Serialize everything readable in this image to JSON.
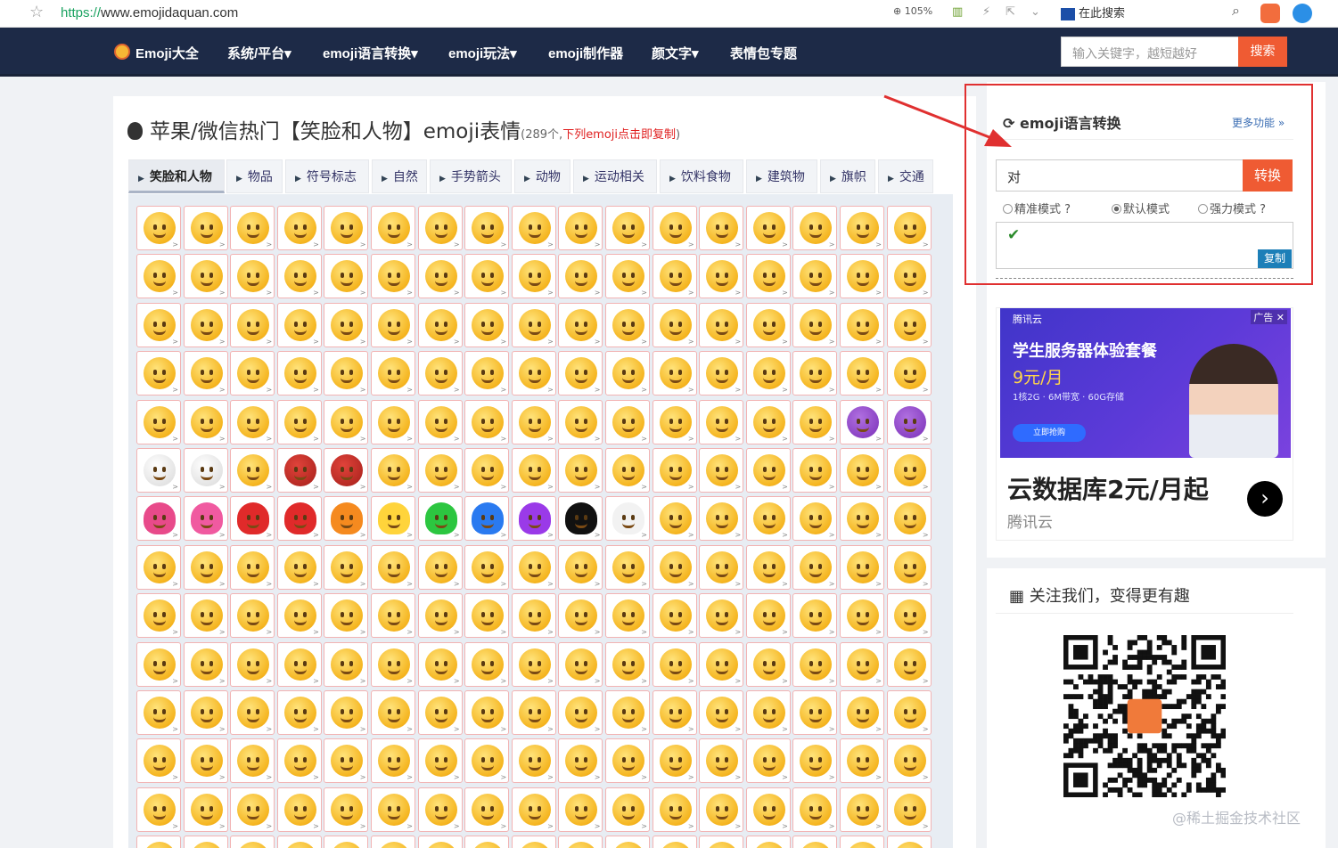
{
  "browser": {
    "url_scheme": "https://",
    "url_rest": "www.emojidaquan.com",
    "zoom": "105%",
    "search_placeholder": "在此搜索"
  },
  "nav": {
    "logo_text": "Emoji大全",
    "items": [
      "系统/平台▾",
      "emoji语言转换▾",
      "emoji玩法▾",
      "emoji制作器",
      "颜文字▾",
      "表情包专题"
    ],
    "search_placeholder": "输入关键字，越短越好",
    "search_button": "搜索"
  },
  "page": {
    "title": "苹果/微信热门【笑脸和人物】emoji表情",
    "count_note": "(289个,",
    "copy_note": "下列emoji点击即复制",
    "close_paren": ")"
  },
  "tabs": [
    "笑脸和人物",
    "物品",
    "符号标志",
    "自然",
    "手势箭头",
    "动物",
    "运动相关",
    "饮料食物",
    "建筑物",
    "旗帜",
    "交通"
  ],
  "converter": {
    "title": "emoji语言转换",
    "more": "更多功能 »",
    "input_value": "对",
    "convert_button": "转换",
    "modes": [
      "精准模式",
      "默认模式",
      "强力模式"
    ],
    "selected_mode": "默认模式",
    "copy_button": "复制"
  },
  "ad": {
    "brand": "腾讯云",
    "tag": "广告",
    "headline": "学生服务器体验套餐",
    "price": "9元/月",
    "spec": "1核2G · 6M带宽 · 60G存储",
    "buy": "立即抢购",
    "big_text": "云数据库2元/月起",
    "sub_text": "腾讯云"
  },
  "follow": {
    "title": "关注我们，变得更有趣"
  },
  "watermark": "@稀土掘金技术社区",
  "colors": {
    "nav_bg": "#1d2a47",
    "accent": "#ef5b33",
    "highlight_box": "#e03030",
    "copy_button": "#1d7fb8"
  },
  "icons": [
    "star-icon",
    "refresh-icon",
    "check-icon",
    "qrcode-icon",
    "apple-icon",
    "search-icon"
  ]
}
